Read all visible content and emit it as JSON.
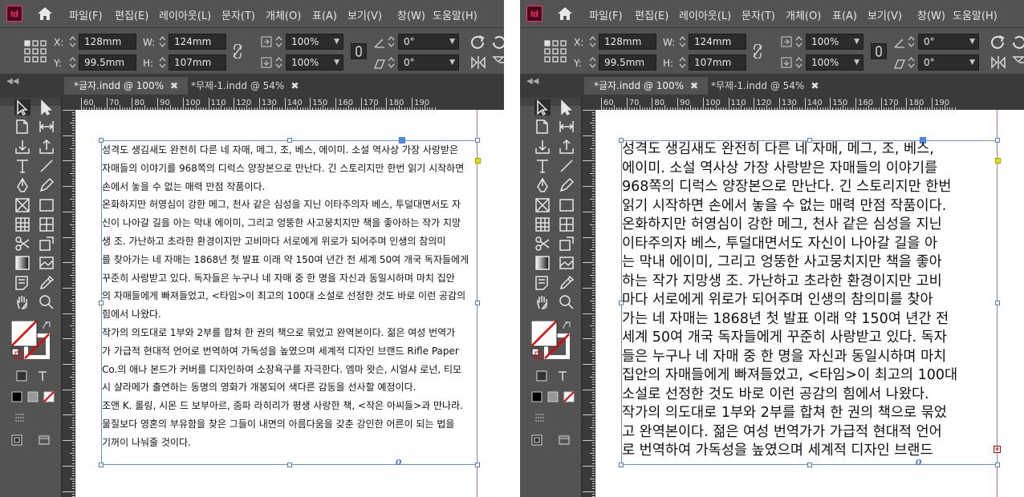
{
  "app": {
    "logo": "Id",
    "home_icon": "home-icon"
  },
  "menu": [
    "파일(F)",
    "편집(E)",
    "레이아웃(L)",
    "문자(T)",
    "개체(O)",
    "표(A)",
    "보기(V)",
    "창(W)",
    "도움말(H)"
  ],
  "controls": {
    "x_label": "X:",
    "x_value": "128mm",
    "y_label": "Y:",
    "y_value": "99.5mm",
    "w_label": "W:",
    "w_value": "124mm",
    "h_label": "H:",
    "h_value": "107mm",
    "scale_x": "100%",
    "scale_y": "100%",
    "rotate": "0°",
    "shear": "0°"
  },
  "tabs": [
    {
      "label": "*글자.indd @ 100%",
      "close": "✖"
    },
    {
      "label": "*무제-1.indd @ 54%",
      "close": "✖"
    }
  ],
  "ruler_ticks": [
    "60",
    "70",
    "80",
    "90",
    "100",
    "110",
    "120",
    "130",
    "140",
    "150",
    "160",
    "170",
    "180",
    "190"
  ],
  "overflow_indicator": "o",
  "overset_icon": "+",
  "left_lines": [
    "성격도 생김새도 완전히 다른 네 자매, 메그, 조, 베스, 에이미. 소설 역사상 가장 사랑받은",
    "자매들의 이야기를 968쪽의 디럭스 양장본으로 만난다. 긴 스토리지만 한번 읽기 시작하면",
    "손에서 놓을 수 없는 매력 만점 작품이다.",
    "온화하지만 허영심이 강한 메그, 천사 같은 심성을 지닌 이타주의자 베스, 투덜대면서도 자",
    "신이 나아갈 길을 아는 막내 에이미, 그리고 엉뚱한 사고뭉치지만 책을 좋아하는 작가 지망",
    "생 조. 가난하고 초라한 환경이지만 고비마다 서로에게 위로가 되어주며 인생의 참의미",
    "를 찾아가는 네 자매는 1868년 첫 발표 이래 약 150여 년간 전 세계 50여 개국 독자들에게",
    "꾸준히 사랑받고 있다. 독자들은 누구나 네 자매 중 한 명을 자신과 동일시하며 마치 집안",
    "의 자매들에게 빠져들었고, <타임>이 최고의 100대 소설로 선정한 것도 바로 이런 공감의",
    "힘에서 나왔다.",
    "작가의 의도대로 1부와 2부를 합쳐 한 권의 책으로 묶었고 완역본이다. 젊은 여성 번역가",
    "가 가급적 현대적 언어로 번역하여 가독성을 높였으며 세계적 디자인 브랜드 Rifle Paper",
    "Co.의 애나 본드가 커버를 디자인하여 소장욕구를 자극한다. 엠마 왓슨, 시얼샤 로넌, 티모",
    "시 샬라메가 출연하는 동명의 영화가 개봉되어 색다른 감동을 선사할 예정이다.",
    "조앤 K. 롤링, 시몬 드 보부아르, 줌파 라히리가 평생 사랑한 책, <작은 아씨들>과 만나라.",
    "물질보다 영혼의 부유함을 찾은 그들이 내면의 아름다움을 갖춘 강인한 어른이 되는 법을",
    "기꺼이 나눠줄 것이다."
  ],
  "right_lines": [
    "성격도 생김새도 완전히 다른 네 자매, 메그, 조, 베스,",
    "에이미. 소설 역사상 가장 사랑받은 자매들의 이야기를",
    "968쪽의 디럭스 양장본으로 만난다. 긴 스토리지만 한번",
    "읽기 시작하면 손에서 놓을 수 없는 매력 만점 작품이다.",
    "온화하지만 허영심이 강한 메그, 천사 같은 심성을 지닌",
    "이타주의자 베스, 투덜대면서도 자신이 나아갈 길을 아",
    "는 막내 에이미, 그리고 엉뚱한 사고뭉치지만 책을 좋아",
    "하는 작가 지망생 조. 가난하고 초라한 환경이지만 고비",
    "마다 서로에게 위로가 되어주며 인생의 참의미를 찾아",
    "가는 네 자매는 1868년 첫 발표 이래 약 150여 년간 전",
    "세계 50여 개국 독자들에게 꾸준히 사랑받고 있다. 독자",
    "들은 누구나 네 자매 중 한 명을 자신과 동일시하며 마치",
    "집안의 자매들에게 빠져들었고, <타임>이 최고의 100대",
    "소설로 선정한 것도 바로 이런 공감의 힘에서 나왔다.",
    "작가의 의도대로 1부와 2부를 합쳐 한 권의 책으로 묶었",
    "고 완역본이다. 젊은 여성 번역가가 가급적 현대적 언어",
    "로 번역하여 가독성을 높였으며 세계적 디자인 브랜드"
  ]
}
